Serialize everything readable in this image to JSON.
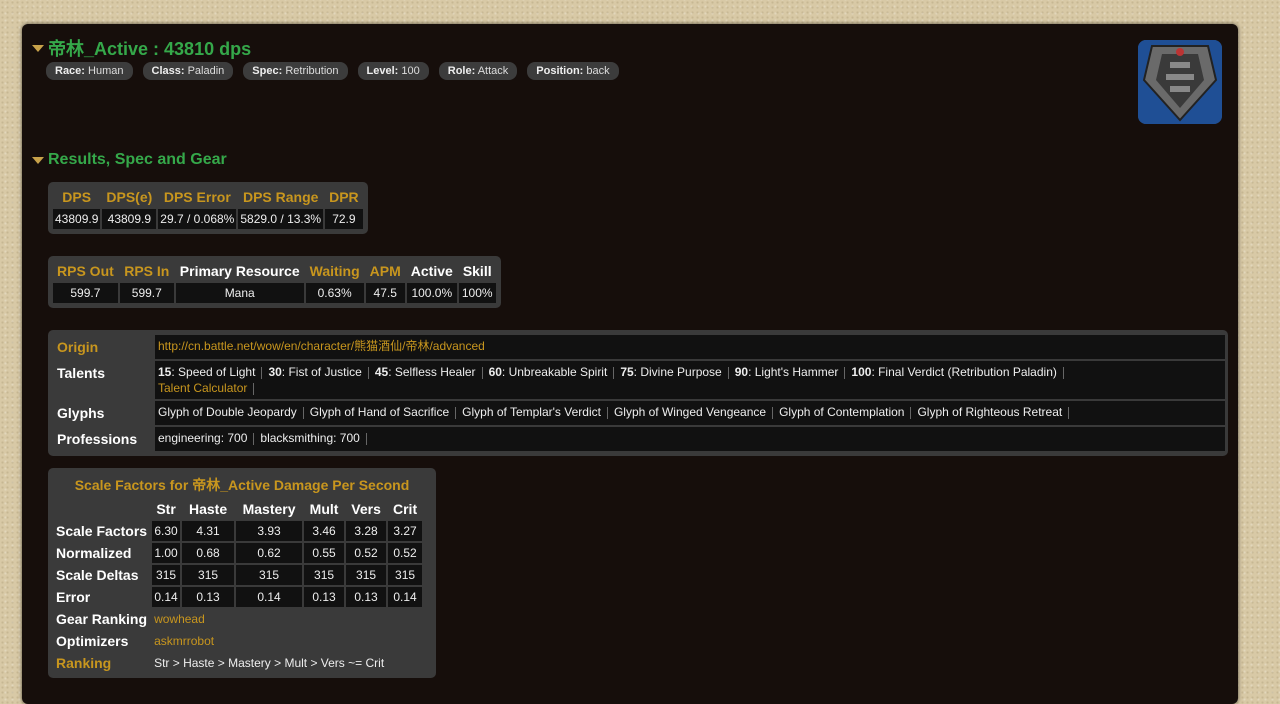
{
  "player": {
    "title": "帝林_Active : 43810 dps",
    "tags": [
      {
        "key": "Race:",
        "value": "Human"
      },
      {
        "key": "Class:",
        "value": "Paladin"
      },
      {
        "key": "Spec:",
        "value": "Retribution"
      },
      {
        "key": "Level:",
        "value": "100"
      },
      {
        "key": "Role:",
        "value": "Attack"
      },
      {
        "key": "Position:",
        "value": "back"
      }
    ]
  },
  "section_title": "Results, Spec and Gear",
  "dps_table": {
    "headers": [
      "DPS",
      "DPS(e)",
      "DPS Error",
      "DPS Range",
      "DPR"
    ],
    "values": [
      "43809.9",
      "43809.9",
      "29.7 / 0.068%",
      "5829.0 / 13.3%",
      "72.9"
    ]
  },
  "rps_table": {
    "headers": [
      "RPS Out",
      "RPS In",
      "Primary Resource",
      "Waiting",
      "APM",
      "Active",
      "Skill"
    ],
    "values": [
      "599.7",
      "599.7",
      "Mana",
      "0.63%",
      "47.5",
      "100.0%",
      "100%"
    ]
  },
  "info": {
    "origin_label": "Origin",
    "origin_url": "http://cn.battle.net/wow/en/character/熊猫酒仙/帝林/advanced",
    "talents_label": "Talents",
    "talents": [
      {
        "level": "15",
        "name": ": Speed of Light"
      },
      {
        "level": "30",
        "name": ": Fist of Justice"
      },
      {
        "level": "45",
        "name": ": Selfless Healer"
      },
      {
        "level": "60",
        "name": ": Unbreakable Spirit"
      },
      {
        "level": "75",
        "name": ": Divine Purpose"
      },
      {
        "level": "90",
        "name": ": Light's Hammer"
      },
      {
        "level": "100",
        "name": ": Final Verdict (Retribution Paladin)"
      }
    ],
    "talent_calculator": "Talent Calculator",
    "glyphs_label": "Glyphs",
    "glyphs": [
      "Glyph of Double Jeopardy",
      "Glyph of Hand of Sacrifice",
      "Glyph of Templar's Verdict",
      "Glyph of Winged Vengeance",
      "Glyph of Contemplation",
      "Glyph of Righteous Retreat"
    ],
    "professions_label": "Professions",
    "professions": [
      "engineering: 700",
      "blacksmithing: 700"
    ]
  },
  "scale": {
    "title": "Scale Factors for 帝林_Active Damage Per Second",
    "headers": [
      "Str",
      "Haste",
      "Mastery",
      "Mult",
      "Vers",
      "Crit"
    ],
    "rows": [
      {
        "label": "Scale Factors",
        "values": [
          "6.30",
          "4.31",
          "3.93",
          "3.46",
          "3.28",
          "3.27"
        ]
      },
      {
        "label": "Normalized",
        "values": [
          "1.00",
          "0.68",
          "0.62",
          "0.55",
          "0.52",
          "0.52"
        ]
      },
      {
        "label": "Scale Deltas",
        "values": [
          "315",
          "315",
          "315",
          "315",
          "315",
          "315"
        ]
      },
      {
        "label": "Error",
        "values": [
          "0.14",
          "0.13",
          "0.14",
          "0.13",
          "0.13",
          "0.14"
        ]
      }
    ],
    "gear_ranking_label": "Gear Ranking",
    "gear_ranking_value": "wowhead",
    "optimizers_label": "Optimizers",
    "optimizers_value": "askmrrobot",
    "ranking_label": "Ranking",
    "ranking_value": "Str > Haste > Mastery > Mult > Vers ~= Crit"
  }
}
